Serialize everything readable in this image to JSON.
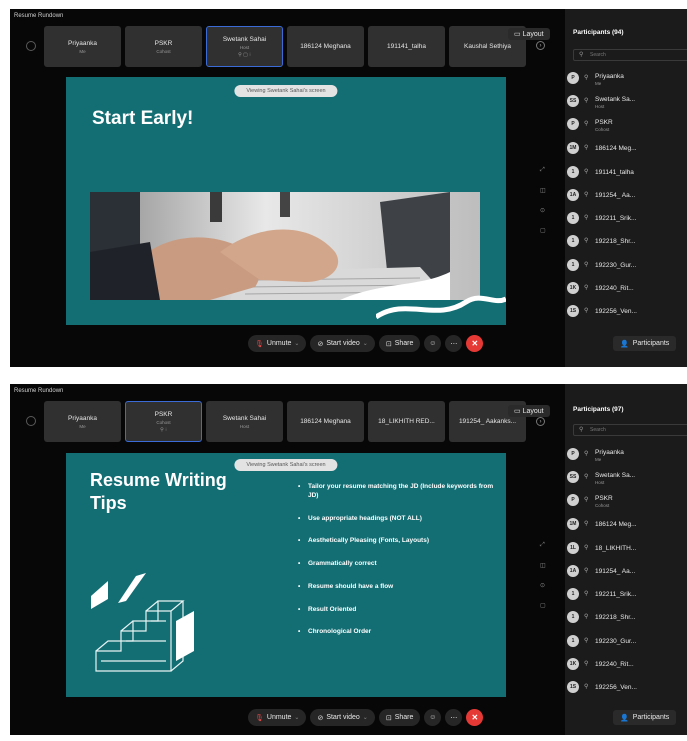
{
  "top": {
    "meeting_title": "Resume Rundown",
    "tiles": [
      {
        "name": "Priyaanka",
        "sub": "Me"
      },
      {
        "name": "PSKR",
        "sub": "Cohost"
      },
      {
        "name": "Swetank Sahai",
        "sub": "Host",
        "icons": "⚲ ▢ ⁝"
      },
      {
        "name": "186124 Meghana",
        "sub": ""
      },
      {
        "name": "191141_talha",
        "sub": ""
      },
      {
        "name": "Kaushal Sethiya",
        "sub": ""
      }
    ],
    "layout_label": "Layout",
    "viewing_text": "Viewing Swetank Sahai's screen",
    "slide_title": "Start Early!",
    "participants_header": "Participants (94)",
    "search_placeholder": "Search",
    "participants": [
      {
        "initials": "P",
        "name": "Priyaanka",
        "role": "Me"
      },
      {
        "initials": "SS",
        "name": "Swetank Sa...",
        "role": "Host"
      },
      {
        "initials": "P",
        "name": "PSKR",
        "role": "Cohost"
      },
      {
        "initials": "1M",
        "name": "186124 Meg...",
        "role": ""
      },
      {
        "initials": "1",
        "name": "191141_talha",
        "role": ""
      },
      {
        "initials": "1A",
        "name": "191254_ Aa...",
        "role": ""
      },
      {
        "initials": "1",
        "name": "192211_Srik...",
        "role": ""
      },
      {
        "initials": "1",
        "name": "192218_Shr...",
        "role": ""
      },
      {
        "initials": "1",
        "name": "192230_Gur...",
        "role": ""
      },
      {
        "initials": "1K",
        "name": "192240_Rit...",
        "role": ""
      },
      {
        "initials": "1S",
        "name": "192256_Ven...",
        "role": ""
      }
    ]
  },
  "bottom": {
    "meeting_title": "Resume Rundown",
    "tiles": [
      {
        "name": "Priyaanka",
        "sub": "Me"
      },
      {
        "name": "PSKR",
        "sub": "Cohost",
        "icons": "⚲ ⁝"
      },
      {
        "name": "Swetank Sahai",
        "sub": "Host"
      },
      {
        "name": "186124 Meghana",
        "sub": ""
      },
      {
        "name": "18_LIKHITH RED...",
        "sub": ""
      },
      {
        "name": "191254_ Aakanks...",
        "sub": ""
      }
    ],
    "layout_label": "Layout",
    "viewing_text": "Viewing Swetank Sahai's screen",
    "slide_title_line1": "Resume Writing",
    "slide_title_line2": "Tips",
    "tips": [
      "Tailor your resume matching the JD (Include keywords from JD)",
      "Use appropriate headings (NOT ALL)",
      "Aesthetically Pleasing (Fonts, Layouts)",
      "Grammatically correct",
      "Resume should have a flow",
      "Result Oriented",
      "Chronological Order"
    ],
    "participants_header": "Participants (97)",
    "search_placeholder": "Search",
    "participants": [
      {
        "initials": "P",
        "name": "Priyaanka",
        "role": "Me"
      },
      {
        "initials": "SS",
        "name": "Swetank Sa...",
        "role": "Host"
      },
      {
        "initials": "P",
        "name": "PSKR",
        "role": "Cohost"
      },
      {
        "initials": "1M",
        "name": "186124 Meg...",
        "role": ""
      },
      {
        "initials": "1L",
        "name": "18_LIKHITH...",
        "role": ""
      },
      {
        "initials": "1A",
        "name": "191254_ Aa...",
        "role": ""
      },
      {
        "initials": "1",
        "name": "192211_Srik...",
        "role": ""
      },
      {
        "initials": "1",
        "name": "192218_Shr...",
        "role": ""
      },
      {
        "initials": "1",
        "name": "192230_Gur...",
        "role": ""
      },
      {
        "initials": "1K",
        "name": "192240_Rit...",
        "role": ""
      },
      {
        "initials": "1S",
        "name": "192256_Ven...",
        "role": ""
      }
    ]
  },
  "toolbar": {
    "unmute_label": "Unmute",
    "start_video_label": "Start video",
    "share_label": "Share",
    "participants_label": "Participants"
  },
  "colors": {
    "slide_teal": "#136e74",
    "panel_bg": "#070707",
    "leave_red": "#e53935",
    "active_tile_border": "#3a6bd6"
  },
  "icons": [
    "settings-icon",
    "microphone-muted-icon",
    "video-off-icon",
    "share-screen-icon",
    "reactions-icon",
    "more-icon",
    "leave-icon",
    "participants-icon",
    "search-icon"
  ]
}
